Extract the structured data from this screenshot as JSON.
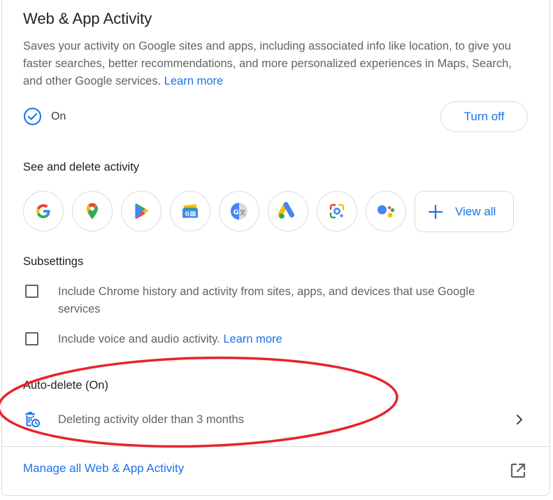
{
  "header": {
    "title": "Web & App Activity",
    "description": "Saves your activity on Google sites and apps, including associated info like location, to give you faster searches, better recommendations, and more personalized experiences in Maps, Search, and other Google services.",
    "learn_more": "Learn more"
  },
  "status": {
    "label": "On",
    "turn_off_label": "Turn off"
  },
  "activity": {
    "title": "See and delete activity",
    "apps": [
      "google",
      "maps",
      "play",
      "news",
      "translate",
      "ads",
      "lens",
      "assistant"
    ],
    "view_all_label": "View all"
  },
  "subsettings": {
    "title": "Subsettings",
    "chrome_history": "Include Chrome history and activity from sites, apps, and devices that use Google services",
    "voice_audio": "Include voice and audio activity.",
    "learn_more": "Learn more"
  },
  "auto_delete": {
    "title": "Auto-delete (On)",
    "text": "Deleting activity older than 3 months"
  },
  "footer": {
    "manage_label": "Manage all Web & App Activity"
  },
  "colors": {
    "accent": "#1a73e8",
    "annotation": "#e8232a",
    "border": "#dadce0"
  }
}
